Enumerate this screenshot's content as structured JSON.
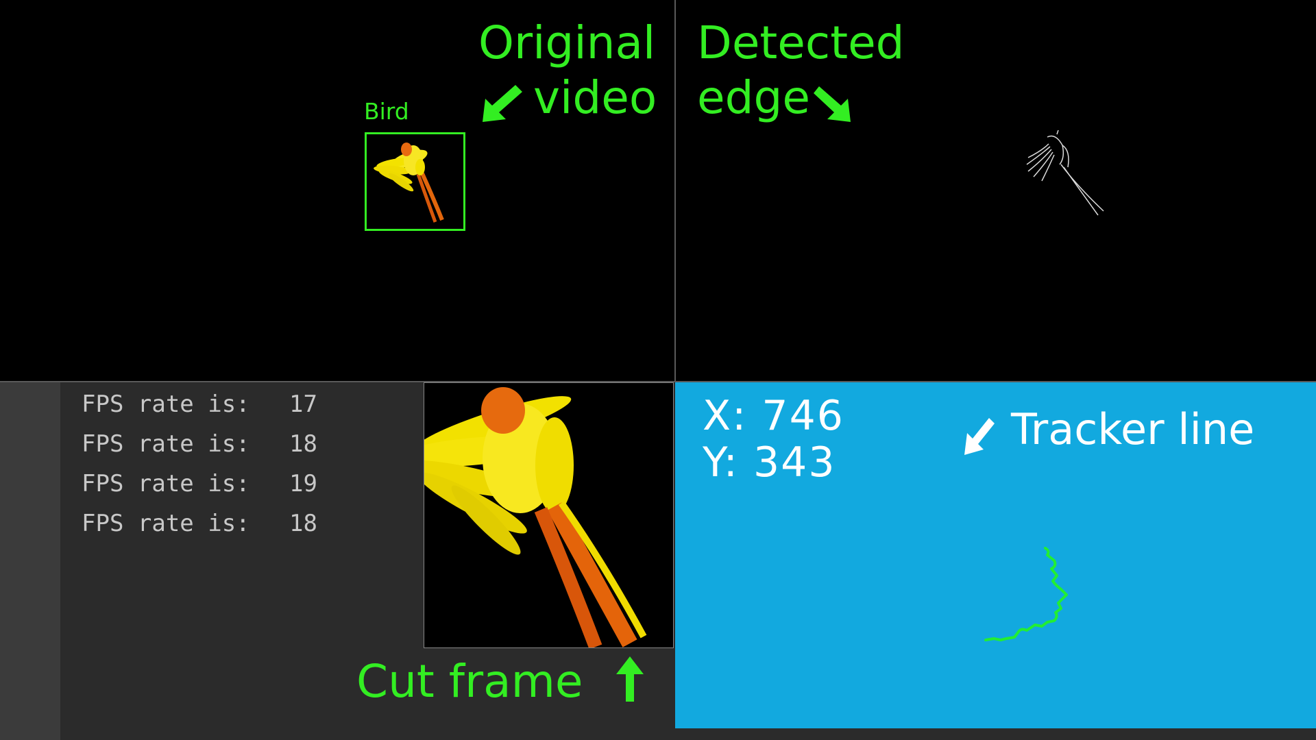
{
  "panels": {
    "original": {
      "label_line1": "Original",
      "label_line2": "video",
      "detection_label": "Bird"
    },
    "edge": {
      "label_line1": "Detected",
      "label_line2": "edge"
    },
    "console": {
      "lines": [
        {
          "text": "FPS rate is:",
          "value": "17"
        },
        {
          "text": "FPS rate is:",
          "value": "18"
        },
        {
          "text": "FPS rate is:",
          "value": "19"
        },
        {
          "text": "FPS rate is:",
          "value": "18"
        }
      ]
    },
    "cut": {
      "label": "Cut frame"
    },
    "tracker": {
      "x_text": "X: 746",
      "y_text": "Y: 343",
      "label": "Tracker line"
    }
  },
  "colors": {
    "annotation": "#33ee22",
    "tracker_bg": "#12a9df",
    "console_bg": "#2b2b2b",
    "console_text": "#c8c8c8",
    "tracker_line": "#22ee33"
  },
  "icons": {
    "original_arrow": "arrow-down-left-icon",
    "edge_arrow": "arrow-down-right-icon",
    "cut_arrow": "arrow-up-icon",
    "tracker_arrow": "arrow-down-left-icon"
  }
}
